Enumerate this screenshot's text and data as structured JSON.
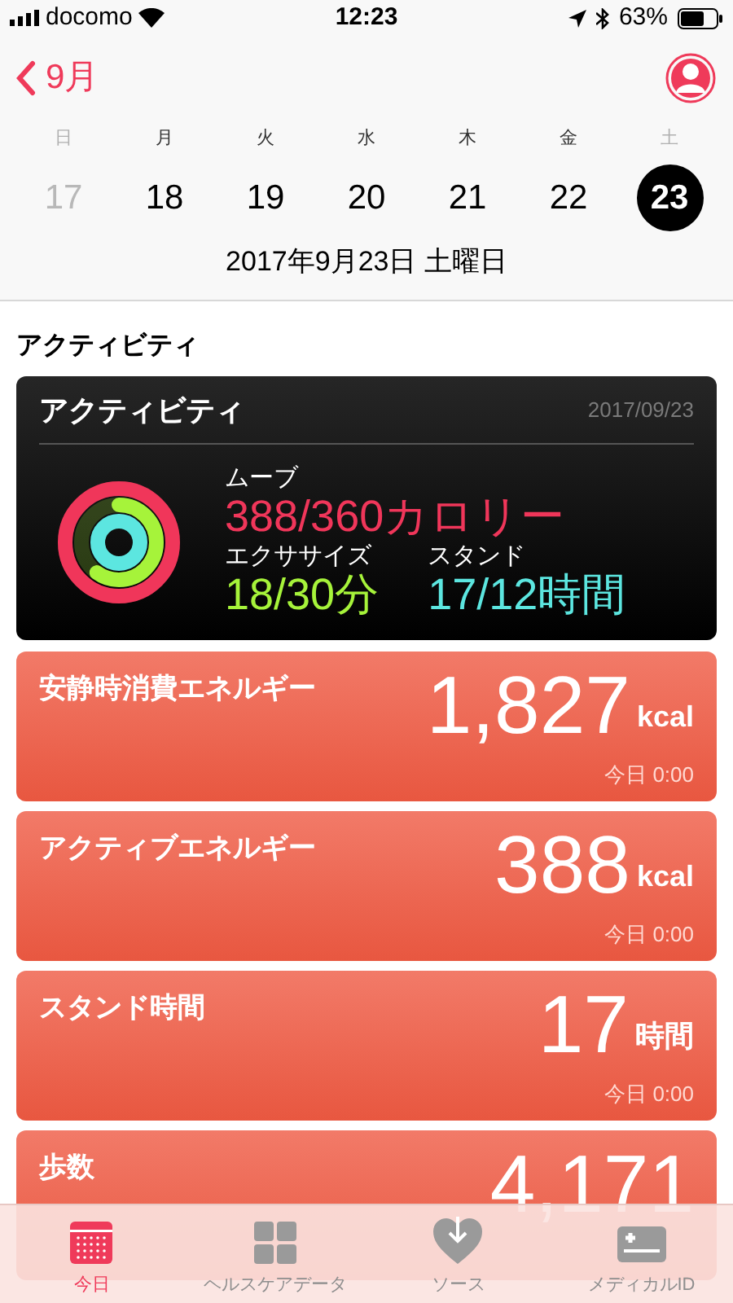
{
  "status_bar": {
    "carrier": "docomo",
    "time": "12:23",
    "battery": "63%"
  },
  "nav": {
    "back_label": "9月"
  },
  "week": [
    {
      "weekday": "日",
      "date": "17",
      "weekend": true,
      "muted": true,
      "selected": false
    },
    {
      "weekday": "月",
      "date": "18",
      "weekend": false,
      "muted": false,
      "selected": false
    },
    {
      "weekday": "火",
      "date": "19",
      "weekend": false,
      "muted": false,
      "selected": false
    },
    {
      "weekday": "水",
      "date": "20",
      "weekend": false,
      "muted": false,
      "selected": false
    },
    {
      "weekday": "木",
      "date": "21",
      "weekend": false,
      "muted": false,
      "selected": false
    },
    {
      "weekday": "金",
      "date": "22",
      "weekend": false,
      "muted": false,
      "selected": false
    },
    {
      "weekday": "土",
      "date": "23",
      "weekend": true,
      "muted": false,
      "selected": true
    }
  ],
  "selected_date": "2017年9月23日 土曜日",
  "section_title": "アクティビティ",
  "activity": {
    "title": "アクティビティ",
    "date": "2017/09/23",
    "rings": [
      {
        "label": "ムーブ",
        "value": "388/360カロリー",
        "color": "#f0365a",
        "level": 1
      },
      {
        "label": "エクササイズ",
        "value": "18/30分",
        "color": "#a6f33a",
        "level": 0.6
      },
      {
        "label": "スタンド",
        "value": "17/12時間",
        "color": "#5ce6e0",
        "level": 1
      }
    ]
  },
  "metrics": [
    {
      "title": "安静時消費エネルギー",
      "value": "1,827",
      "unit": "kcal",
      "time": "今日 0:00"
    },
    {
      "title": "アクティブエネルギー",
      "value": "388",
      "unit": "kcal",
      "time": "今日 0:00"
    },
    {
      "title": "スタンド時間",
      "value": "17",
      "unit": "時間",
      "time": "今日 0:00"
    },
    {
      "title": "歩数",
      "value": "4,171"
    }
  ],
  "tabs": [
    {
      "label": "今日",
      "kind": "calendar",
      "selected": true
    },
    {
      "label": "ヘルスケアデータ",
      "kind": "grid",
      "selected": false
    },
    {
      "label": "ソース",
      "kind": "heart",
      "selected": false
    },
    {
      "label": "メディカルID",
      "kind": "card",
      "selected": false
    }
  ]
}
